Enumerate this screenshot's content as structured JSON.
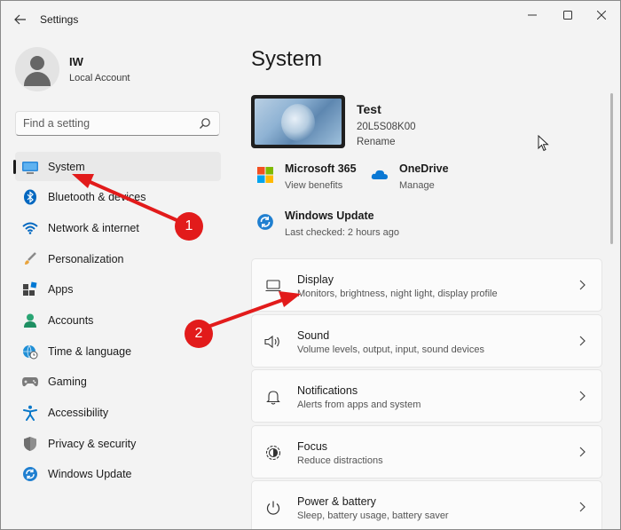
{
  "window": {
    "title": "Settings",
    "back_icon": "arrow-left-icon",
    "controls": [
      "minimize",
      "maximize",
      "close"
    ]
  },
  "profile": {
    "name": "IW",
    "account_type": "Local Account"
  },
  "search": {
    "placeholder": "Find a setting"
  },
  "sidebar": {
    "items": [
      {
        "label": "System",
        "icon": "monitor-icon",
        "active": true
      },
      {
        "label": "Bluetooth & devices",
        "icon": "bluetooth-icon",
        "active": false
      },
      {
        "label": "Network & internet",
        "icon": "wifi-icon",
        "active": false
      },
      {
        "label": "Personalization",
        "icon": "brush-icon",
        "active": false
      },
      {
        "label": "Apps",
        "icon": "apps-icon",
        "active": false
      },
      {
        "label": "Accounts",
        "icon": "person-icon",
        "active": false
      },
      {
        "label": "Time & language",
        "icon": "globe-clock-icon",
        "active": false
      },
      {
        "label": "Gaming",
        "icon": "gamepad-icon",
        "active": false
      },
      {
        "label": "Accessibility",
        "icon": "accessibility-icon",
        "active": false
      },
      {
        "label": "Privacy & security",
        "icon": "shield-icon",
        "active": false
      },
      {
        "label": "Windows Update",
        "icon": "update-icon",
        "active": false
      }
    ]
  },
  "main": {
    "title": "System",
    "device": {
      "name": "Test",
      "model": "20L5S08K00",
      "rename": "Rename"
    },
    "quick_links": [
      {
        "title": "Microsoft 365",
        "sub": "View benefits",
        "icon": "microsoft-logo-icon"
      },
      {
        "title": "OneDrive",
        "sub": "Manage",
        "icon": "cloud-icon"
      },
      {
        "title": "Windows Update",
        "sub": "Last checked: 2 hours ago",
        "icon": "update-icon"
      }
    ],
    "cards": [
      {
        "title": "Display",
        "sub": "Monitors, brightness, night light, display profile",
        "icon": "display-icon"
      },
      {
        "title": "Sound",
        "sub": "Volume levels, output, input, sound devices",
        "icon": "speaker-icon"
      },
      {
        "title": "Notifications",
        "sub": "Alerts from apps and system",
        "icon": "bell-icon"
      },
      {
        "title": "Focus",
        "sub": "Reduce distractions",
        "icon": "focus-icon"
      },
      {
        "title": "Power & battery",
        "sub": "Sleep, battery usage, battery saver",
        "icon": "power-icon"
      }
    ]
  },
  "annotations": {
    "badge_1": "1",
    "badge_2": "2",
    "color": "#e21b1b"
  },
  "colors": {
    "accent": "#0067c0",
    "background": "#f3f3f3",
    "card": "#fbfbfb"
  }
}
